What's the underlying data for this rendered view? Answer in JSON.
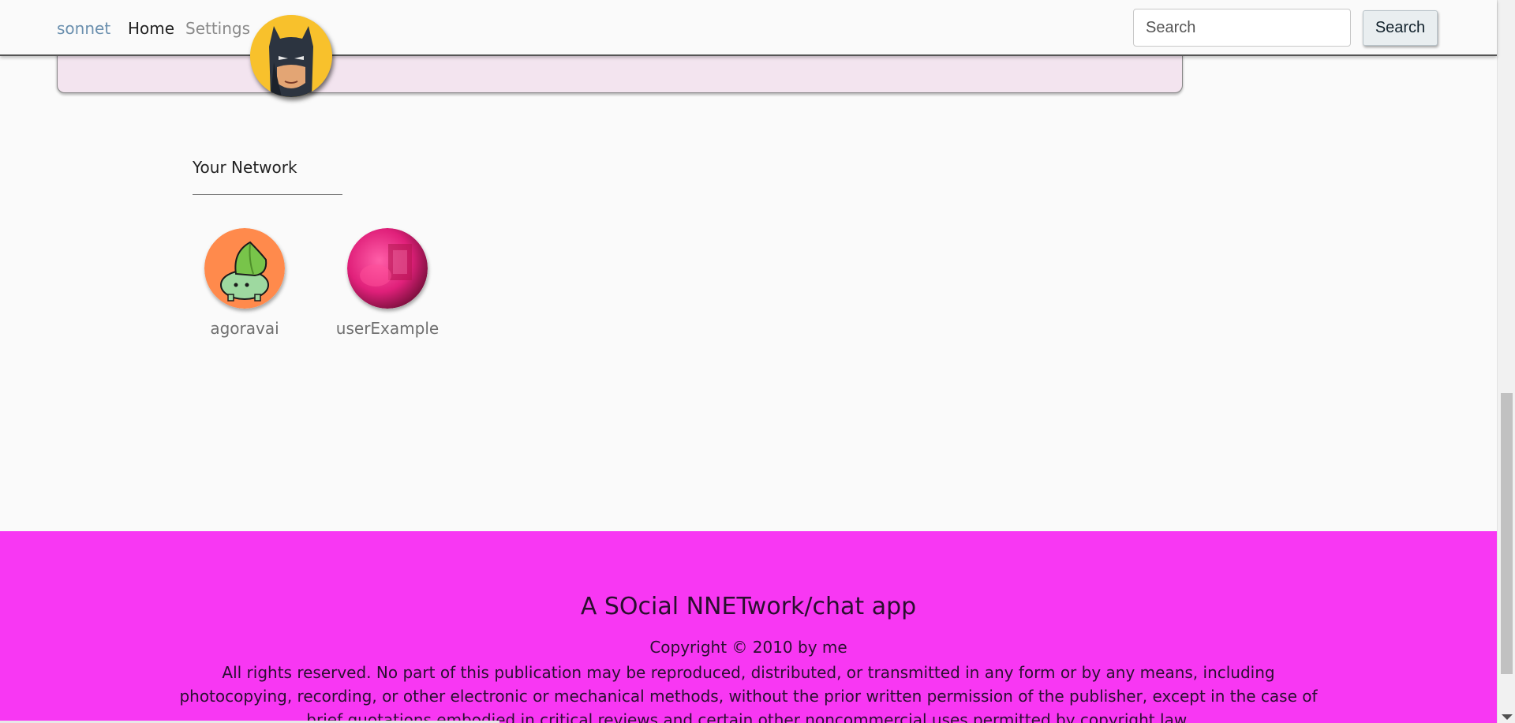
{
  "nav": {
    "brand": "sonnet",
    "home": "Home",
    "settings": "Settings",
    "avatar_icon": "batman-avatar-icon",
    "search_placeholder": "Search",
    "search_button": "Search"
  },
  "network": {
    "title": "Your Network",
    "friends": [
      {
        "name": "agoravai",
        "icon": "bulbasaur-avatar-icon"
      },
      {
        "name": "userExample",
        "icon": "pink-abstract-avatar-icon"
      }
    ]
  },
  "footer": {
    "title": "A SOcial NNETwork/chat app",
    "copyright": "Copyright © 2010 by me",
    "rights": "All rights reserved. No part of this publication may be reproduced, distributed, or transmitted in any form or by any means, including photocopying, recording, or other electronic or mechanical methods, without the prior written permission of the publisher, except in the case of brief quotations embodied in critical reviews and certain other noncommercial uses permitted by copyright law."
  },
  "colors": {
    "footer_bg": "#f837f3",
    "card_bg": "#f3e4ef",
    "brand": "#6a8fae"
  }
}
